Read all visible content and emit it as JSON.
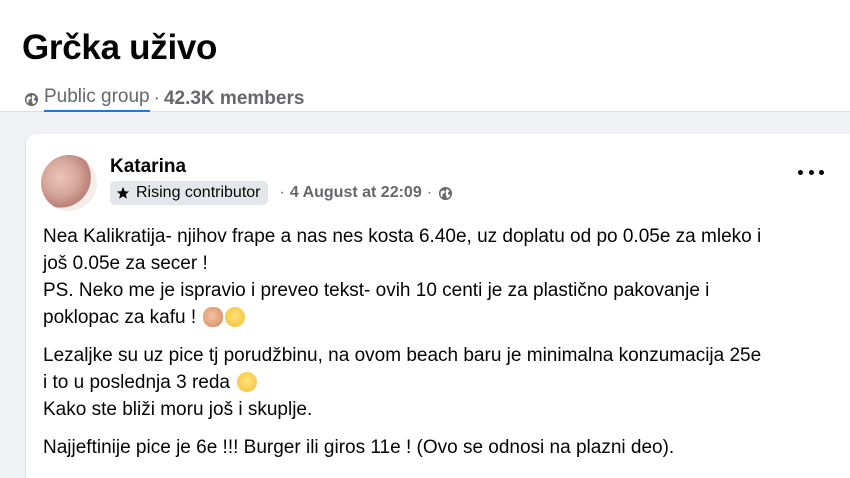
{
  "group": {
    "title": "Grčka uživo",
    "privacy": "Public group",
    "separator": "·",
    "members": "42.3K members"
  },
  "post": {
    "author": "Katarina",
    "badge": "Rising contributor",
    "separator": "·",
    "date": "4 August at 22:09",
    "audience_icon": "globe-icon",
    "more_icon": "more-options-icon",
    "paragraphs": [
      {
        "lines": [
          "Nea Kalikratija- njihov frape a nas nes kosta 6.40e, uz doplatu od po 0.05e za mleko i",
          "još 0.05e za secer !",
          "PS. Neko me je ispravio i preveo tekst- ovih 10 centi je za plastično pakovanje i",
          "poklopac za kafu !"
        ]
      },
      {
        "lines": [
          "Lezaljke su uz pice tj porudžbinu, na ovom beach baru je minimalna konzumacija 25e",
          "i to u poslednja 3 reda",
          "Kako ste bliži moru još i skuplje."
        ]
      },
      {
        "lines": [
          "Najjeftinije pice je 6e !!! Burger ili giros 11e ! (Ovo se odnosi na plazni deo)."
        ]
      }
    ]
  }
}
